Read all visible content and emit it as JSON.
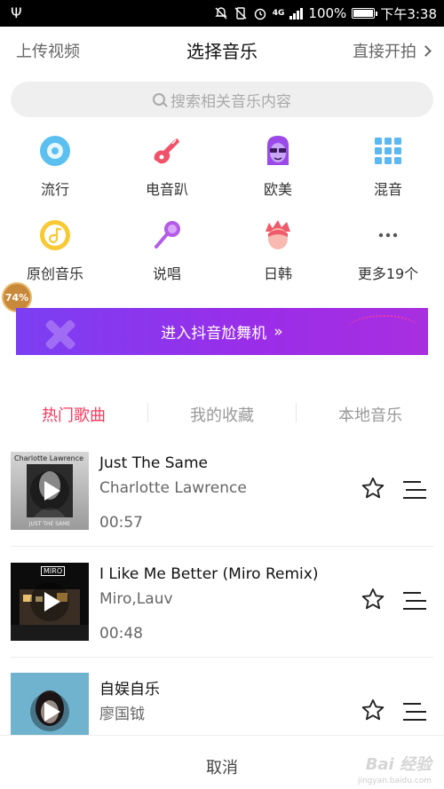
{
  "status_bar": {
    "network": "4G",
    "battery": "100%",
    "time": "下午3:38"
  },
  "header": {
    "left_label": "上传视频",
    "title": "选择音乐",
    "right_label": "直接开拍"
  },
  "search": {
    "placeholder": "搜索相关音乐内容"
  },
  "categories": [
    {
      "label": "流行",
      "icon": "disc-icon"
    },
    {
      "label": "电音趴",
      "icon": "electric-guitar-icon"
    },
    {
      "label": "欧美",
      "icon": "sunglasses-face-icon"
    },
    {
      "label": "混音",
      "icon": "grid-dots-icon"
    },
    {
      "label": "原创音乐",
      "icon": "music-note-circle-icon"
    },
    {
      "label": "说唱",
      "icon": "microphone-icon"
    },
    {
      "label": "日韩",
      "icon": "anime-face-icon"
    },
    {
      "label": "更多19个",
      "icon": "more-dots-icon"
    }
  ],
  "progress_badge": {
    "text": "74%",
    "value": 0.74
  },
  "banner": {
    "label": "进入抖音尬舞机",
    "arrow": "»"
  },
  "tabs": [
    {
      "label": "热门歌曲",
      "active": true
    },
    {
      "label": "我的收藏",
      "active": false
    },
    {
      "label": "本地音乐",
      "active": false
    }
  ],
  "songs": [
    {
      "title": "Just The Same",
      "artist": "Charlotte Lawrence",
      "duration": "00:57",
      "cover_top": "Charlotte Lawrence",
      "cover_bottom": "JUST THE SAME"
    },
    {
      "title": "I Like Me Better (Miro Remix)",
      "artist": "Miro,Lauv",
      "duration": "00:48",
      "cover_top": "MIRO",
      "cover_bottom": ""
    },
    {
      "title": "自娱自乐",
      "artist": "廖国钺",
      "duration": "",
      "cover_top": "",
      "cover_bottom": ""
    }
  ],
  "footer": {
    "cancel_label": "取消",
    "watermark": "Bai 经验",
    "watermark_sub": "jingyan.baidu.com"
  },
  "colors": {
    "accent": "#f43a5c",
    "banner_start": "#7b3ff2",
    "banner_end": "#a82fe0"
  }
}
